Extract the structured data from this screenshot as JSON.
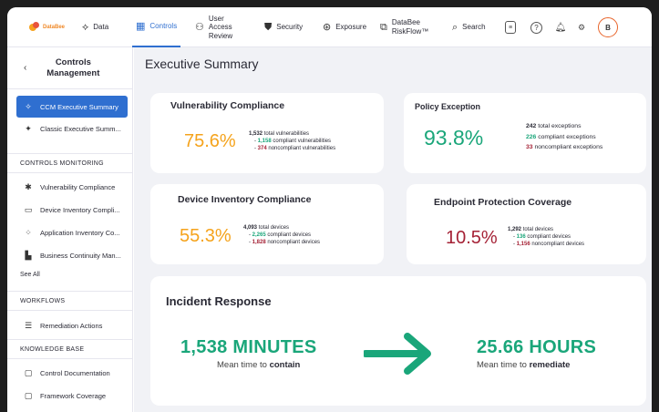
{
  "brand": {
    "name": "DataBee",
    "accent": "#2f6fd0",
    "logo_colors": [
      "#f6a21e",
      "#e8533c"
    ]
  },
  "nav": {
    "items": [
      {
        "label": "Data",
        "icon": "data-icon"
      },
      {
        "label": "Controls",
        "icon": "grid-icon",
        "active": true
      },
      {
        "label": "User Access Review",
        "icon": "users-icon"
      },
      {
        "label": "Security",
        "icon": "shield-icon"
      },
      {
        "label": "Exposure",
        "icon": "exposure-icon"
      },
      {
        "label": "DataBee RiskFlow™",
        "icon": "riskflow-icon"
      },
      {
        "label": "Search",
        "icon": "search-icon"
      }
    ],
    "user_initial": "B",
    "right_icons": [
      "book-icon",
      "help-icon",
      "bell-icon",
      "integrations-icon"
    ]
  },
  "sidebar": {
    "title": "Controls Management",
    "items_top": [
      {
        "label": "CCM Executive Summary",
        "icon": "sparkle-icon",
        "active": true
      },
      {
        "label": "Classic Executive Summ...",
        "icon": "sparkle-icon"
      }
    ],
    "sections": [
      {
        "title": "CONTROLS MONITORING",
        "items": [
          {
            "label": "Vulnerability Compliance",
            "icon": "bug-icon"
          },
          {
            "label": "Device Inventory Compli...",
            "icon": "monitor-icon"
          },
          {
            "label": "Application Inventory Co...",
            "icon": "apps-icon"
          },
          {
            "label": "Business Continuity Man...",
            "icon": "building-icon"
          }
        ],
        "see_all": "See All"
      },
      {
        "title": "WORKFLOWS",
        "items": [
          {
            "label": "Remediation Actions",
            "icon": "checklist-icon"
          }
        ]
      },
      {
        "title": "KNOWLEDGE BASE",
        "items": [
          {
            "label": "Control Documentation",
            "icon": "book-open-icon"
          },
          {
            "label": "Framework Coverage",
            "icon": "book-open-icon"
          }
        ]
      }
    ]
  },
  "main": {
    "title": "Executive Summary",
    "vulnerability": {
      "title": "Vulnerability Compliance",
      "percent": "75.6%",
      "total_num": "1,532",
      "total_txt": "total vulnerabilities",
      "compliant_num": "1,158",
      "compliant_txt": "compliant vulnerabilities",
      "noncompliant_num": "374",
      "noncompliant_txt": "noncompliant vulnerabilities"
    },
    "policy": {
      "title": "Policy Exception",
      "percent": "93.8%",
      "total_num": "242",
      "total_txt": "total exceptions",
      "compliant_num": "226",
      "compliant_txt": "compliant exceptions",
      "noncompliant_num": "33",
      "noncompliant_txt": "noncompliant exceptions"
    },
    "device": {
      "title": "Device Inventory Compliance",
      "percent": "55.3%",
      "total_num": "4,093",
      "total_txt": "total devices",
      "compliant_num": "2,265",
      "compliant_txt": "compliant devices",
      "noncompliant_num": "1,828",
      "noncompliant_txt": "noncompliant devices"
    },
    "endpoint": {
      "title": "Endpoint Protection Coverage",
      "percent": "10.5%",
      "total_num": "1,292",
      "total_txt": "total devices",
      "compliant_num": "136",
      "compliant_txt": "compliant devices",
      "noncompliant_num": "1,156",
      "noncompliant_txt": "noncompliant devices"
    },
    "incident": {
      "title": "Incident Response",
      "contain_value": "1,538 MINUTES",
      "contain_prefix": "Mean time to",
      "contain_word": "contain",
      "remediate_value": "25.66 HOURS",
      "remediate_prefix": "Mean time to",
      "remediate_word": "remediate"
    }
  },
  "colors": {
    "orange": "#f5a31c",
    "green": "#1aa67a",
    "red": "#a52236"
  }
}
